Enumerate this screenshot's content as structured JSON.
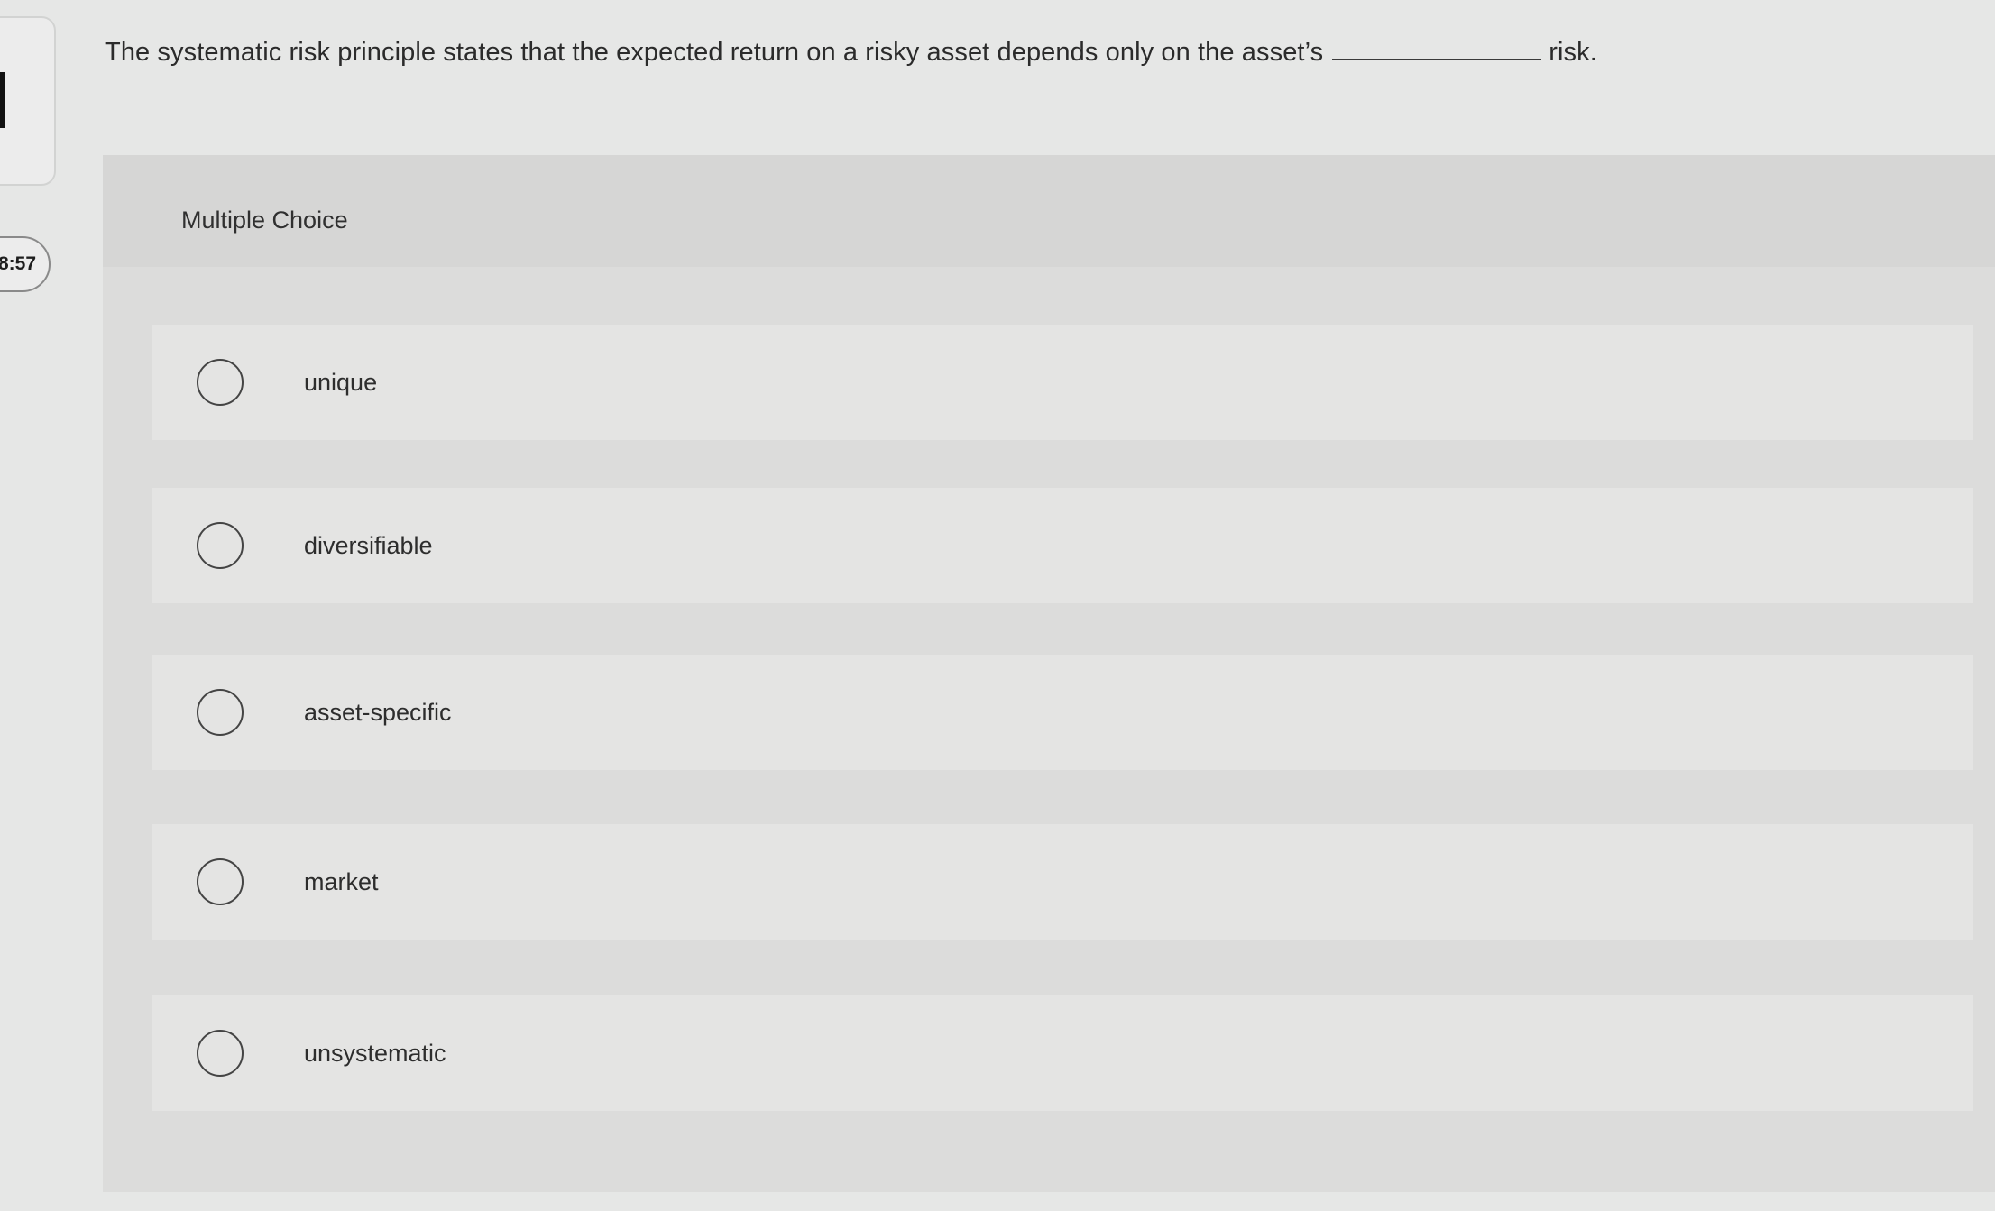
{
  "timer": "8:57",
  "question": {
    "text_before": "The systematic risk principle states that the expected return on a risky asset depends only on the asset’s",
    "text_after": "risk."
  },
  "section_label": "Multiple Choice",
  "options": [
    {
      "label": "unique"
    },
    {
      "label": "diversifiable"
    },
    {
      "label": "asset-specific"
    },
    {
      "label": "market"
    },
    {
      "label": "unsystematic"
    }
  ]
}
